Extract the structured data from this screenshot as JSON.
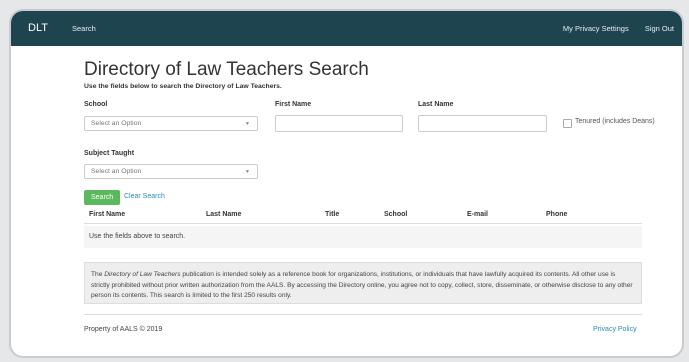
{
  "navbar": {
    "brand": "DLT",
    "search_link": "Search",
    "privacy_link": "My Privacy Settings",
    "signout_link": "Sign Out"
  },
  "page": {
    "title": "Directory of Law Teachers Search",
    "subtitle": "Use the fields below to search the Directory of Law Teachers."
  },
  "form": {
    "school_label": "School",
    "school_placeholder": "Select an Option",
    "first_name_label": "First Name",
    "first_name_value": "",
    "last_name_label": "Last Name",
    "last_name_value": "",
    "tenured_label": "Tenured (includes Deans)",
    "tenured_checked": false,
    "subject_label": "Subject Taught",
    "subject_placeholder": "Select an Option",
    "search_button": "Search",
    "clear_link": "Clear Search"
  },
  "results": {
    "columns": [
      "First Name",
      "Last Name",
      "Title",
      "School",
      "E-mail",
      "Phone"
    ],
    "empty_message": "Use the fields above to search."
  },
  "notice": {
    "pre": "The ",
    "publication": "Directory of Law Teachers",
    "post": " publication is intended solely as a reference book for organizations, institutions, or individuals that have lawfully acquired its contents. All other use is strictly prohibited without prior written authorization from the AALS. By accessing the Directory online, you agree not to copy, collect, store, disseminate, or otherwise disclose to any other person its contents. This search is limited to the first 250 results only."
  },
  "footer": {
    "copyright": "Property of AALS © 2019",
    "privacy_policy": "Privacy Policy"
  },
  "colors": {
    "navbar": "#1e4450",
    "button_green": "#5cb85c",
    "link_blue": "#2a8ab8"
  }
}
